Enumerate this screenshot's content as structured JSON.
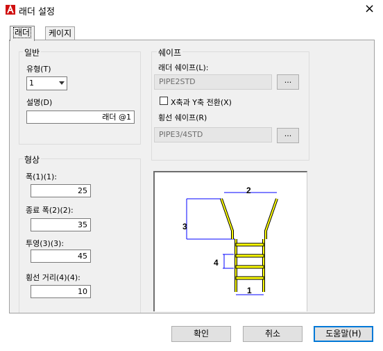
{
  "window": {
    "title": "래더 설정",
    "close_icon": "×"
  },
  "tabs": [
    {
      "label": "래더"
    },
    {
      "label": "케이지"
    }
  ],
  "general": {
    "title": "일반",
    "type_label": "유형(T)",
    "type_value": "1",
    "desc_label": "설명(D)",
    "desc_value": "래더 @1"
  },
  "shape_group": {
    "title": "쉐이프",
    "ladder_shape_label": "래더 쉐이프(L):",
    "ladder_shape_value": "PIPE2STD",
    "swap_label": "X축과 Y축 전환(X)",
    "swap_checked": false,
    "rung_shape_label": "횡선 쉐이프(R)",
    "rung_shape_value": "PIPE3/4STD",
    "browse_label": "..."
  },
  "geometry": {
    "title": "형상",
    "width_label": "폭(1)(1):",
    "width_value": "25",
    "end_width_label": "종료 폭(2)(2):",
    "end_width_value": "35",
    "projection_label": "투영(3)(3):",
    "projection_value": "45",
    "rung_dist_label": "횡선 거리(4)(4):",
    "rung_dist_value": "10"
  },
  "diagram": {
    "n1": "1",
    "n2": "2",
    "n3": "3",
    "n4": "4"
  },
  "buttons": {
    "ok": "확인",
    "cancel": "취소",
    "help": "도움말(H)"
  },
  "colors": {
    "rail": "#ffff00",
    "outline": "#000000",
    "dim": "#0000ff",
    "app_icon": "#d01010"
  }
}
